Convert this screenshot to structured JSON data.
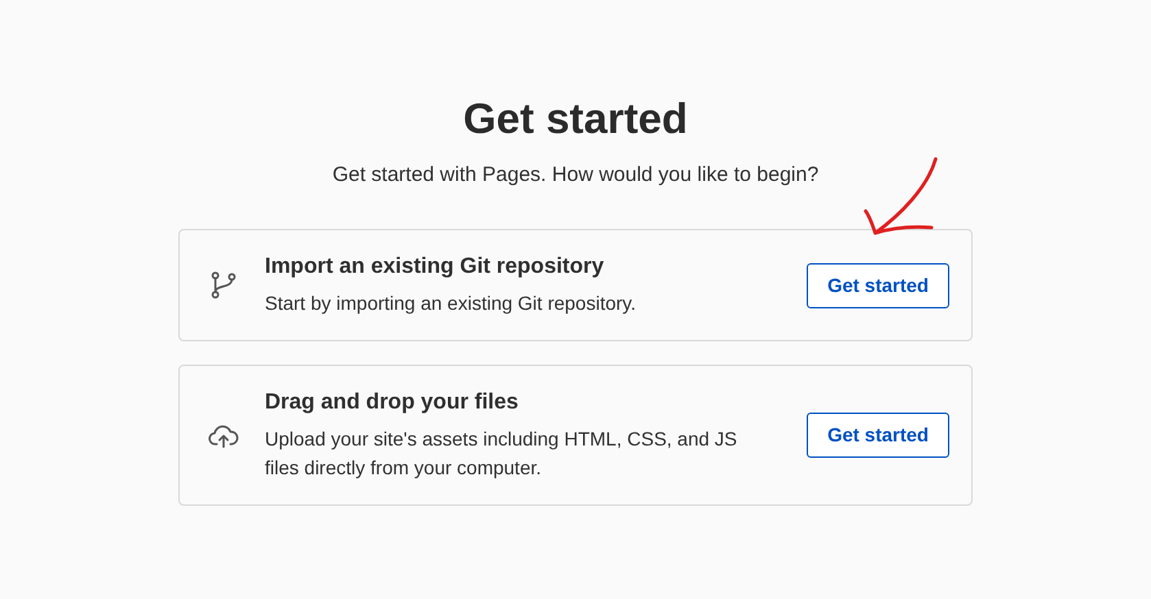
{
  "title": "Get started",
  "subtitle": "Get started with Pages. How would you like to begin?",
  "options": [
    {
      "kind": "git",
      "title": "Import an existing Git repository",
      "description": "Start by importing an existing Git repository.",
      "button": "Get started"
    },
    {
      "kind": "upload",
      "title": "Drag and drop your files",
      "description": "Upload your site's assets including HTML, CSS, and JS files directly from your computer.",
      "button": "Get started"
    }
  ]
}
